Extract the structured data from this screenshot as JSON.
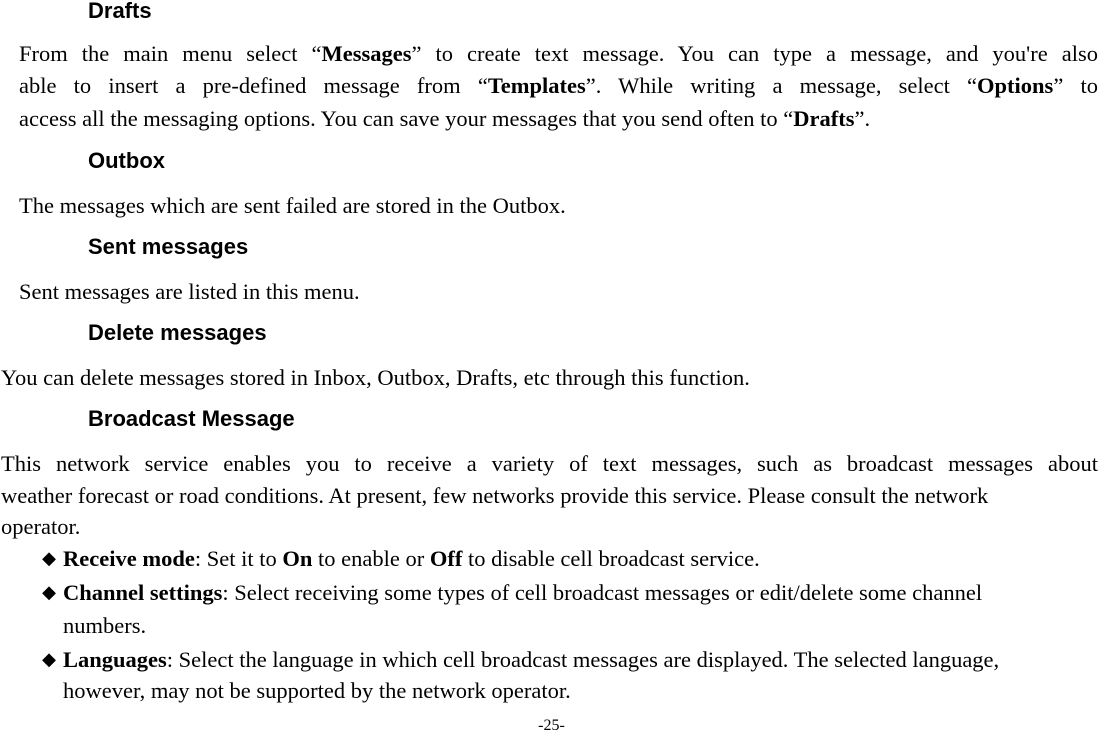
{
  "page": {
    "page_number": "-25-"
  },
  "sections": {
    "drafts": {
      "heading": "Drafts",
      "lines": [
        [
          "From the main menu select “",
          "Messages",
          "” to create text message. You can type a message, and you're also"
        ],
        [
          "able to insert a pre-defined message from “",
          "Templates",
          "”. While writing a message, select “",
          "Options",
          "” to"
        ],
        [
          "access all the messaging options. You can save your messages that you send often to “",
          "Drafts",
          "”."
        ]
      ]
    },
    "outbox": {
      "heading": "Outbox",
      "text": "The messages which are sent failed are stored in the Outbox."
    },
    "sent": {
      "heading": "Sent messages",
      "text": "Sent messages are listed in this menu."
    },
    "delete": {
      "heading": "Delete messages",
      "text": "You can delete messages stored in Inbox, Outbox, Drafts, etc through this function."
    },
    "broadcast": {
      "heading": "Broadcast Message",
      "lines": [
        "This network service enables you to receive a variety of text messages, such as broadcast messages about",
        "weather forecast or road conditions. At present, few networks provide this service. Please consult the network",
        "operator."
      ],
      "bullets": [
        {
          "icon": "◆",
          "term": "Receive mode",
          "parts": [
            ": Set it to ",
            "On",
            " to enable or ",
            "Off",
            " to disable cell broadcast service."
          ]
        },
        {
          "icon": "◆",
          "term": "Channel settings",
          "line1": ": Select receiving some types of cell broadcast messages or edit/delete some channel",
          "line2": "numbers."
        },
        {
          "icon": "◆",
          "term": "Languages",
          "line1": ": Select the language in which cell broadcast messages are displayed. The selected language,",
          "line2": "however, may not be supported by the network operator."
        }
      ]
    }
  }
}
